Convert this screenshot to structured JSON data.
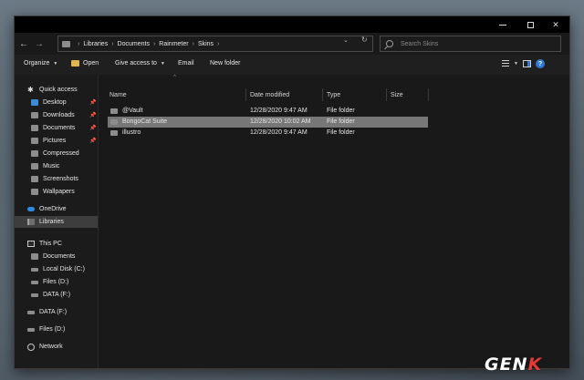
{
  "window": {
    "controls": {
      "minimize": "—",
      "maximize": "",
      "close": "✕"
    }
  },
  "toolbar": {
    "back_icon": "←",
    "forward_icon": "→",
    "recent_icon": "⌄",
    "up_icon": "↑",
    "breadcrumbs": [
      "Libraries",
      "Documents",
      "Rainmeter",
      "Skins"
    ],
    "address_dropdown_icon": "⌄",
    "refresh_icon": "↻",
    "search_placeholder": "Search Skins"
  },
  "commands": {
    "organize": "Organize",
    "open": "Open",
    "give_access": "Give access to",
    "email": "Email",
    "new_folder": "New folder",
    "help": "?"
  },
  "sidebar": {
    "quick_access": "Quick access",
    "quick_items": [
      {
        "label": "Desktop",
        "pinned": true
      },
      {
        "label": "Downloads",
        "pinned": true
      },
      {
        "label": "Documents",
        "pinned": true
      },
      {
        "label": "Pictures",
        "pinned": true
      },
      {
        "label": "Compressed",
        "pinned": false
      },
      {
        "label": "Music",
        "pinned": false
      },
      {
        "label": "Screenshots",
        "pinned": false
      },
      {
        "label": "Wallpapers",
        "pinned": false
      }
    ],
    "onedrive": "OneDrive",
    "libraries": "Libraries",
    "this_pc": "This PC",
    "pc_items": [
      "Documents",
      "Local Disk (C:)",
      "Files (D:)",
      "DATA (F:)"
    ],
    "drives": [
      "DATA (F:)",
      "Files (D:)"
    ],
    "network": "Network"
  },
  "columns": {
    "name": "Name",
    "date": "Date modified",
    "type": "Type",
    "size": "Size"
  },
  "files": [
    {
      "name": "@Vault",
      "date": "12/28/2020 9:47 AM",
      "type": "File folder",
      "size": ""
    },
    {
      "name": "BongoCat Suite",
      "date": "12/28/2020 10:02 AM",
      "type": "File folder",
      "size": ""
    },
    {
      "name": "illustro",
      "date": "12/28/2020 9:47 AM",
      "type": "File folder",
      "size": ""
    }
  ],
  "watermark": {
    "part1": "GEN",
    "part2": "K"
  },
  "colors": {
    "selection": "#777777",
    "accent": "#2f7bd6",
    "window_bg": "#1f1f1f"
  }
}
